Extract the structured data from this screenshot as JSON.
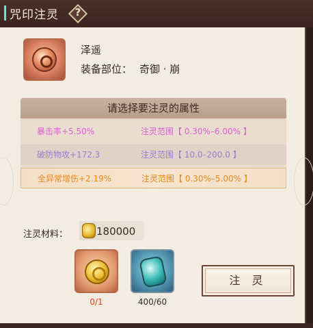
{
  "header": {
    "title": "咒印注灵",
    "help_label": "?"
  },
  "item": {
    "icon": "charm-medallion-icon",
    "name": "泽遥",
    "slot_label": "装备部位：",
    "slot_value": "奇御 · 崩"
  },
  "attributes": {
    "heading": "请选择要注灵的属性",
    "rows": [
      {
        "name": "暴击率+5.50%",
        "range": "注灵范围【 0.30%–6.00% 】",
        "color": "#e05bd3",
        "selected": false
      },
      {
        "name": "破防物攻+172.3",
        "range": "注灵范围【 10.0–200.0 】",
        "color": "#9b7ad6",
        "selected": false
      },
      {
        "name": "全异常增伤+2.19%",
        "range": "注灵范围【 0.30%–5.00% 】",
        "color": "#e8861e",
        "selected": true
      }
    ]
  },
  "material": {
    "label": "注灵材料：",
    "currency_icon": "gold-ingot-icon",
    "amount": "180000"
  },
  "slots": [
    {
      "icon": "gold-coin-icon",
      "count": "0/1"
    },
    {
      "icon": "jade-gem-icon",
      "count": "400/60"
    }
  ],
  "action": {
    "inject_label": "注 灵"
  }
}
